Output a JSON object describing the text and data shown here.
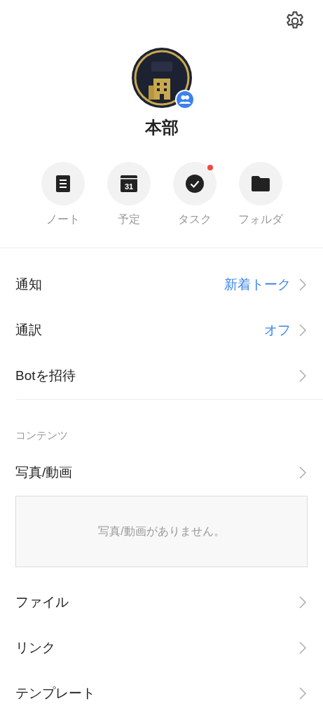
{
  "profile": {
    "name": "本部"
  },
  "shortcuts": [
    {
      "kind": "note",
      "label": "ノート",
      "badge": false
    },
    {
      "kind": "calendar",
      "label": "予定",
      "icon_text": "31",
      "badge": false
    },
    {
      "kind": "task",
      "label": "タスク",
      "badge": true
    },
    {
      "kind": "folder",
      "label": "フォルダ",
      "badge": false
    }
  ],
  "settings": [
    {
      "label": "通知",
      "value": "新着トーク"
    },
    {
      "label": "通訳",
      "value": "オフ"
    },
    {
      "label": "Botを招待"
    }
  ],
  "contents": {
    "header": "コンテンツ",
    "items": [
      {
        "label": "写真/動画",
        "empty_text": "写真/動画がありません。"
      },
      {
        "label": "ファイル"
      },
      {
        "label": "リンク"
      },
      {
        "label": "テンプレート"
      }
    ]
  }
}
